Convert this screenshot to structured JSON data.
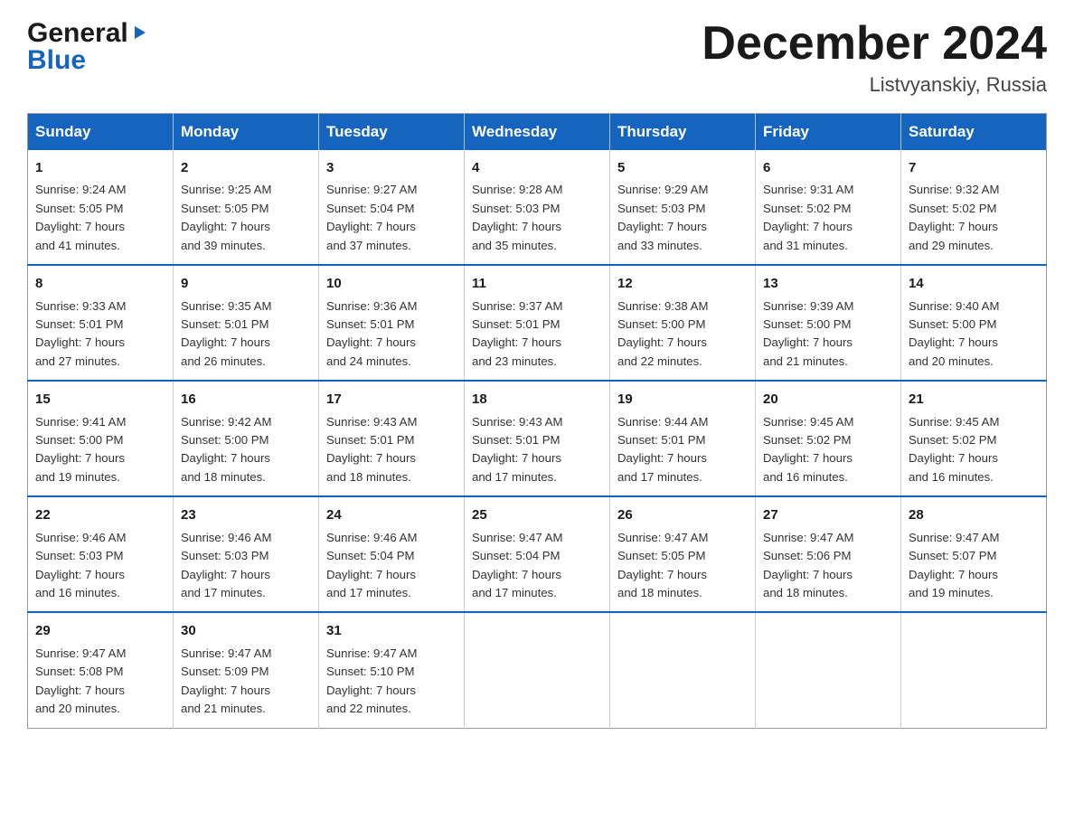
{
  "logo": {
    "general": "General",
    "blue": "Blue"
  },
  "header": {
    "month": "December 2024",
    "location": "Listvyanskiy, Russia"
  },
  "weekdays": [
    "Sunday",
    "Monday",
    "Tuesday",
    "Wednesday",
    "Thursday",
    "Friday",
    "Saturday"
  ],
  "weeks": [
    [
      {
        "day": "1",
        "info": "Sunrise: 9:24 AM\nSunset: 5:05 PM\nDaylight: 7 hours\nand 41 minutes."
      },
      {
        "day": "2",
        "info": "Sunrise: 9:25 AM\nSunset: 5:05 PM\nDaylight: 7 hours\nand 39 minutes."
      },
      {
        "day": "3",
        "info": "Sunrise: 9:27 AM\nSunset: 5:04 PM\nDaylight: 7 hours\nand 37 minutes."
      },
      {
        "day": "4",
        "info": "Sunrise: 9:28 AM\nSunset: 5:03 PM\nDaylight: 7 hours\nand 35 minutes."
      },
      {
        "day": "5",
        "info": "Sunrise: 9:29 AM\nSunset: 5:03 PM\nDaylight: 7 hours\nand 33 minutes."
      },
      {
        "day": "6",
        "info": "Sunrise: 9:31 AM\nSunset: 5:02 PM\nDaylight: 7 hours\nand 31 minutes."
      },
      {
        "day": "7",
        "info": "Sunrise: 9:32 AM\nSunset: 5:02 PM\nDaylight: 7 hours\nand 29 minutes."
      }
    ],
    [
      {
        "day": "8",
        "info": "Sunrise: 9:33 AM\nSunset: 5:01 PM\nDaylight: 7 hours\nand 27 minutes."
      },
      {
        "day": "9",
        "info": "Sunrise: 9:35 AM\nSunset: 5:01 PM\nDaylight: 7 hours\nand 26 minutes."
      },
      {
        "day": "10",
        "info": "Sunrise: 9:36 AM\nSunset: 5:01 PM\nDaylight: 7 hours\nand 24 minutes."
      },
      {
        "day": "11",
        "info": "Sunrise: 9:37 AM\nSunset: 5:01 PM\nDaylight: 7 hours\nand 23 minutes."
      },
      {
        "day": "12",
        "info": "Sunrise: 9:38 AM\nSunset: 5:00 PM\nDaylight: 7 hours\nand 22 minutes."
      },
      {
        "day": "13",
        "info": "Sunrise: 9:39 AM\nSunset: 5:00 PM\nDaylight: 7 hours\nand 21 minutes."
      },
      {
        "day": "14",
        "info": "Sunrise: 9:40 AM\nSunset: 5:00 PM\nDaylight: 7 hours\nand 20 minutes."
      }
    ],
    [
      {
        "day": "15",
        "info": "Sunrise: 9:41 AM\nSunset: 5:00 PM\nDaylight: 7 hours\nand 19 minutes."
      },
      {
        "day": "16",
        "info": "Sunrise: 9:42 AM\nSunset: 5:00 PM\nDaylight: 7 hours\nand 18 minutes."
      },
      {
        "day": "17",
        "info": "Sunrise: 9:43 AM\nSunset: 5:01 PM\nDaylight: 7 hours\nand 18 minutes."
      },
      {
        "day": "18",
        "info": "Sunrise: 9:43 AM\nSunset: 5:01 PM\nDaylight: 7 hours\nand 17 minutes."
      },
      {
        "day": "19",
        "info": "Sunrise: 9:44 AM\nSunset: 5:01 PM\nDaylight: 7 hours\nand 17 minutes."
      },
      {
        "day": "20",
        "info": "Sunrise: 9:45 AM\nSunset: 5:02 PM\nDaylight: 7 hours\nand 16 minutes."
      },
      {
        "day": "21",
        "info": "Sunrise: 9:45 AM\nSunset: 5:02 PM\nDaylight: 7 hours\nand 16 minutes."
      }
    ],
    [
      {
        "day": "22",
        "info": "Sunrise: 9:46 AM\nSunset: 5:03 PM\nDaylight: 7 hours\nand 16 minutes."
      },
      {
        "day": "23",
        "info": "Sunrise: 9:46 AM\nSunset: 5:03 PM\nDaylight: 7 hours\nand 17 minutes."
      },
      {
        "day": "24",
        "info": "Sunrise: 9:46 AM\nSunset: 5:04 PM\nDaylight: 7 hours\nand 17 minutes."
      },
      {
        "day": "25",
        "info": "Sunrise: 9:47 AM\nSunset: 5:04 PM\nDaylight: 7 hours\nand 17 minutes."
      },
      {
        "day": "26",
        "info": "Sunrise: 9:47 AM\nSunset: 5:05 PM\nDaylight: 7 hours\nand 18 minutes."
      },
      {
        "day": "27",
        "info": "Sunrise: 9:47 AM\nSunset: 5:06 PM\nDaylight: 7 hours\nand 18 minutes."
      },
      {
        "day": "28",
        "info": "Sunrise: 9:47 AM\nSunset: 5:07 PM\nDaylight: 7 hours\nand 19 minutes."
      }
    ],
    [
      {
        "day": "29",
        "info": "Sunrise: 9:47 AM\nSunset: 5:08 PM\nDaylight: 7 hours\nand 20 minutes."
      },
      {
        "day": "30",
        "info": "Sunrise: 9:47 AM\nSunset: 5:09 PM\nDaylight: 7 hours\nand 21 minutes."
      },
      {
        "day": "31",
        "info": "Sunrise: 9:47 AM\nSunset: 5:10 PM\nDaylight: 7 hours\nand 22 minutes."
      },
      {
        "day": "",
        "info": ""
      },
      {
        "day": "",
        "info": ""
      },
      {
        "day": "",
        "info": ""
      },
      {
        "day": "",
        "info": ""
      }
    ]
  ]
}
